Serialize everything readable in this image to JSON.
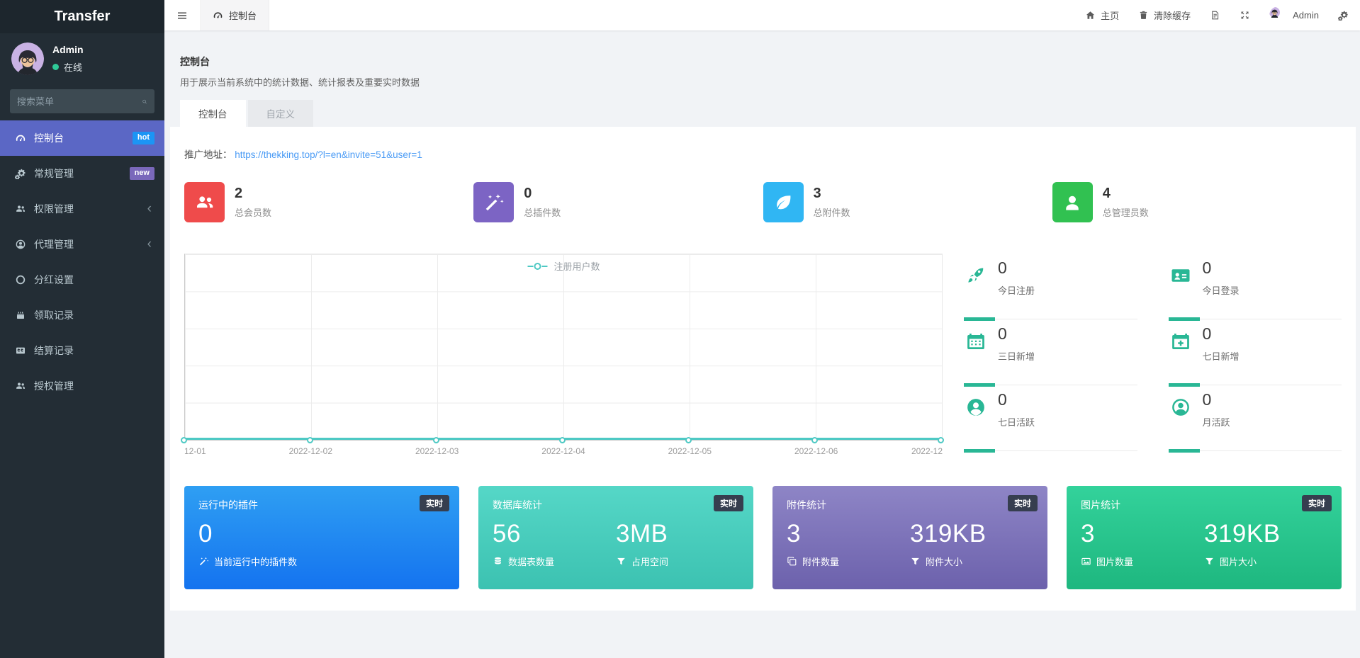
{
  "colors": {
    "accent_teal": "#29b795",
    "link_blue": "#4a9bf5",
    "menu_active": "#5b67c5",
    "badge_hot": "#1b95f5",
    "badge_new": "#7a68bb",
    "online_green": "#2fc998"
  },
  "brand": {
    "title": "Transfer"
  },
  "user_panel": {
    "name": "Admin",
    "status_label": "在线"
  },
  "menu_search": {
    "placeholder": "搜索菜单"
  },
  "sidebar": {
    "items": [
      {
        "label": "控制台",
        "badge": "hot"
      },
      {
        "label": "常规管理",
        "badge": "new"
      },
      {
        "label": "权限管理",
        "arrow": "‹"
      },
      {
        "label": "代理管理",
        "arrow": "‹"
      },
      {
        "label": "分红设置"
      },
      {
        "label": "领取记录"
      },
      {
        "label": "结算记录"
      },
      {
        "label": "授权管理"
      }
    ]
  },
  "topbar": {
    "active_tab": "控制台",
    "home_label": "主页",
    "clear_cache_label": "清除缓存",
    "user_name": "Admin"
  },
  "page_header": {
    "title": "控制台",
    "description": "用于展示当前系统中的统计数据、统计报表及重要实时数据",
    "tabs": [
      {
        "label": "控制台"
      },
      {
        "label": "自定义"
      }
    ]
  },
  "promotion": {
    "label": "推广地址：",
    "url_text": "https://thekking.top/?l=en&invite=51&user=1"
  },
  "summary_stats": [
    {
      "value": "2",
      "label": "总会员数",
      "color": "#ef4b4b",
      "icon": "users-icon"
    },
    {
      "value": "0",
      "label": "总插件数",
      "color": "#7c64c4",
      "icon": "magic-wand-icon"
    },
    {
      "value": "3",
      "label": "总附件数",
      "color": "#30b6f3",
      "icon": "leaf-icon"
    },
    {
      "value": "4",
      "label": "总管理员数",
      "color": "#31c151",
      "icon": "user-icon"
    }
  ],
  "chart_data": {
    "type": "line",
    "series": [
      {
        "name": "注册用户数",
        "values": [
          0,
          0,
          0,
          0,
          0,
          0,
          0
        ]
      }
    ],
    "x": [
      "12-01",
      "2022-12-02",
      "2022-12-03",
      "2022-12-04",
      "2022-12-05",
      "2022-12-06",
      "2022-12"
    ],
    "ylim": [
      0,
      1
    ],
    "grid": true,
    "legend_position": "top-center",
    "line_color": "#4ec9c4"
  },
  "daily_stats": [
    {
      "value": "0",
      "label": "今日注册",
      "icon": "rocket-icon"
    },
    {
      "value": "0",
      "label": "今日登录",
      "icon": "id-card-icon"
    },
    {
      "value": "0",
      "label": "三日新增",
      "icon": "calendar-icon"
    },
    {
      "value": "0",
      "label": "七日新增",
      "icon": "calendar-plus-icon"
    },
    {
      "value": "0",
      "label": "七日活跃",
      "icon": "user-circle-icon"
    },
    {
      "value": "0",
      "label": "月活跃",
      "icon": "user-circle-outline-icon"
    }
  ],
  "realtime_cards": [
    {
      "title": "运行中的插件",
      "badge": "实时",
      "gradient": [
        "#2f9ff3",
        "#1473ef"
      ],
      "metrics": [
        {
          "value": "0",
          "label": "当前运行中的插件数",
          "icon": "magic-wand-icon"
        }
      ]
    },
    {
      "title": "数据库统计",
      "badge": "实时",
      "gradient": [
        "#55d7c7",
        "#3cc2b1"
      ],
      "metrics": [
        {
          "value": "56",
          "label": "数据表数量",
          "icon": "database-icon"
        },
        {
          "value": "3MB",
          "label": "占用空间",
          "icon": "funnel-icon"
        }
      ]
    },
    {
      "title": "附件统计",
      "badge": "实时",
      "gradient": [
        "#8e85c6",
        "#6c61ac"
      ],
      "metrics": [
        {
          "value": "3",
          "label": "附件数量",
          "icon": "copy-icon"
        },
        {
          "value": "319KB",
          "label": "附件大小",
          "icon": "funnel-icon"
        }
      ]
    },
    {
      "title": "图片统计",
      "badge": "实时",
      "gradient": [
        "#33d29b",
        "#1eb77f"
      ],
      "metrics": [
        {
          "value": "3",
          "label": "图片数量",
          "icon": "image-icon"
        },
        {
          "value": "319KB",
          "label": "图片大小",
          "icon": "funnel-icon"
        }
      ]
    }
  ]
}
